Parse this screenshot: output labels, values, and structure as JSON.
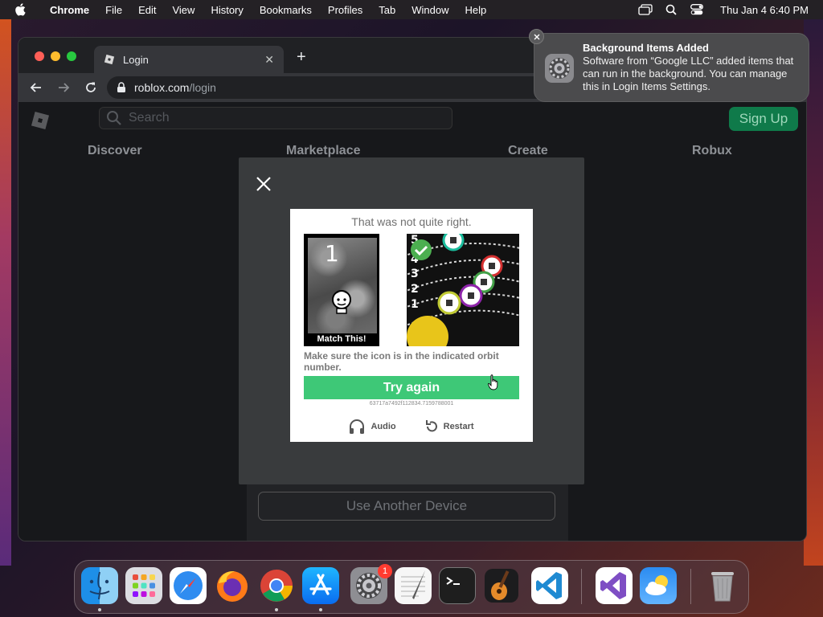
{
  "menubar": {
    "app_name": "Chrome",
    "menus": [
      "File",
      "Edit",
      "View",
      "History",
      "Bookmarks",
      "Profiles",
      "Tab",
      "Window",
      "Help"
    ],
    "clock": "Thu Jan 4  6:40 PM"
  },
  "browser": {
    "tab_title": "Login",
    "tab_close": "✕",
    "new_tab": "+",
    "url_host": "roblox.com",
    "url_path": "/login"
  },
  "roblox": {
    "search_placeholder": "Search",
    "signup_label": "Sign Up",
    "nav": [
      "Discover",
      "Marketplace",
      "Create",
      "Robux"
    ],
    "another_device_label": "Use Another Device"
  },
  "captcha": {
    "title": "That was not quite right.",
    "reference_number": "1",
    "reference_caption": "Match This!",
    "orbit_numbers": [
      "5",
      "4",
      "3",
      "2",
      "1"
    ],
    "hint": "Make sure the icon is in the indicated orbit number.",
    "try_again_label": "Try again",
    "session_id": "63717a7492f112834.7159788001",
    "audio_label": "Audio",
    "restart_label": "Restart"
  },
  "notification": {
    "title": "Background Items Added",
    "body": "Software from “Google LLC” added items that can run in the background. You can manage this in Login Items Settings."
  },
  "dock": {
    "apps": [
      "finder",
      "launchpad",
      "safari",
      "firefox",
      "chrome",
      "app-store",
      "system-settings",
      "textedit",
      "terminal",
      "garageband",
      "vscode",
      "visual-studio",
      "weather",
      "trash"
    ],
    "system_settings_badge": "1"
  },
  "colors": {
    "try_again_green": "#3ec877",
    "signup_green": "#0f7a4a",
    "badge_red": "#ff3b30"
  }
}
